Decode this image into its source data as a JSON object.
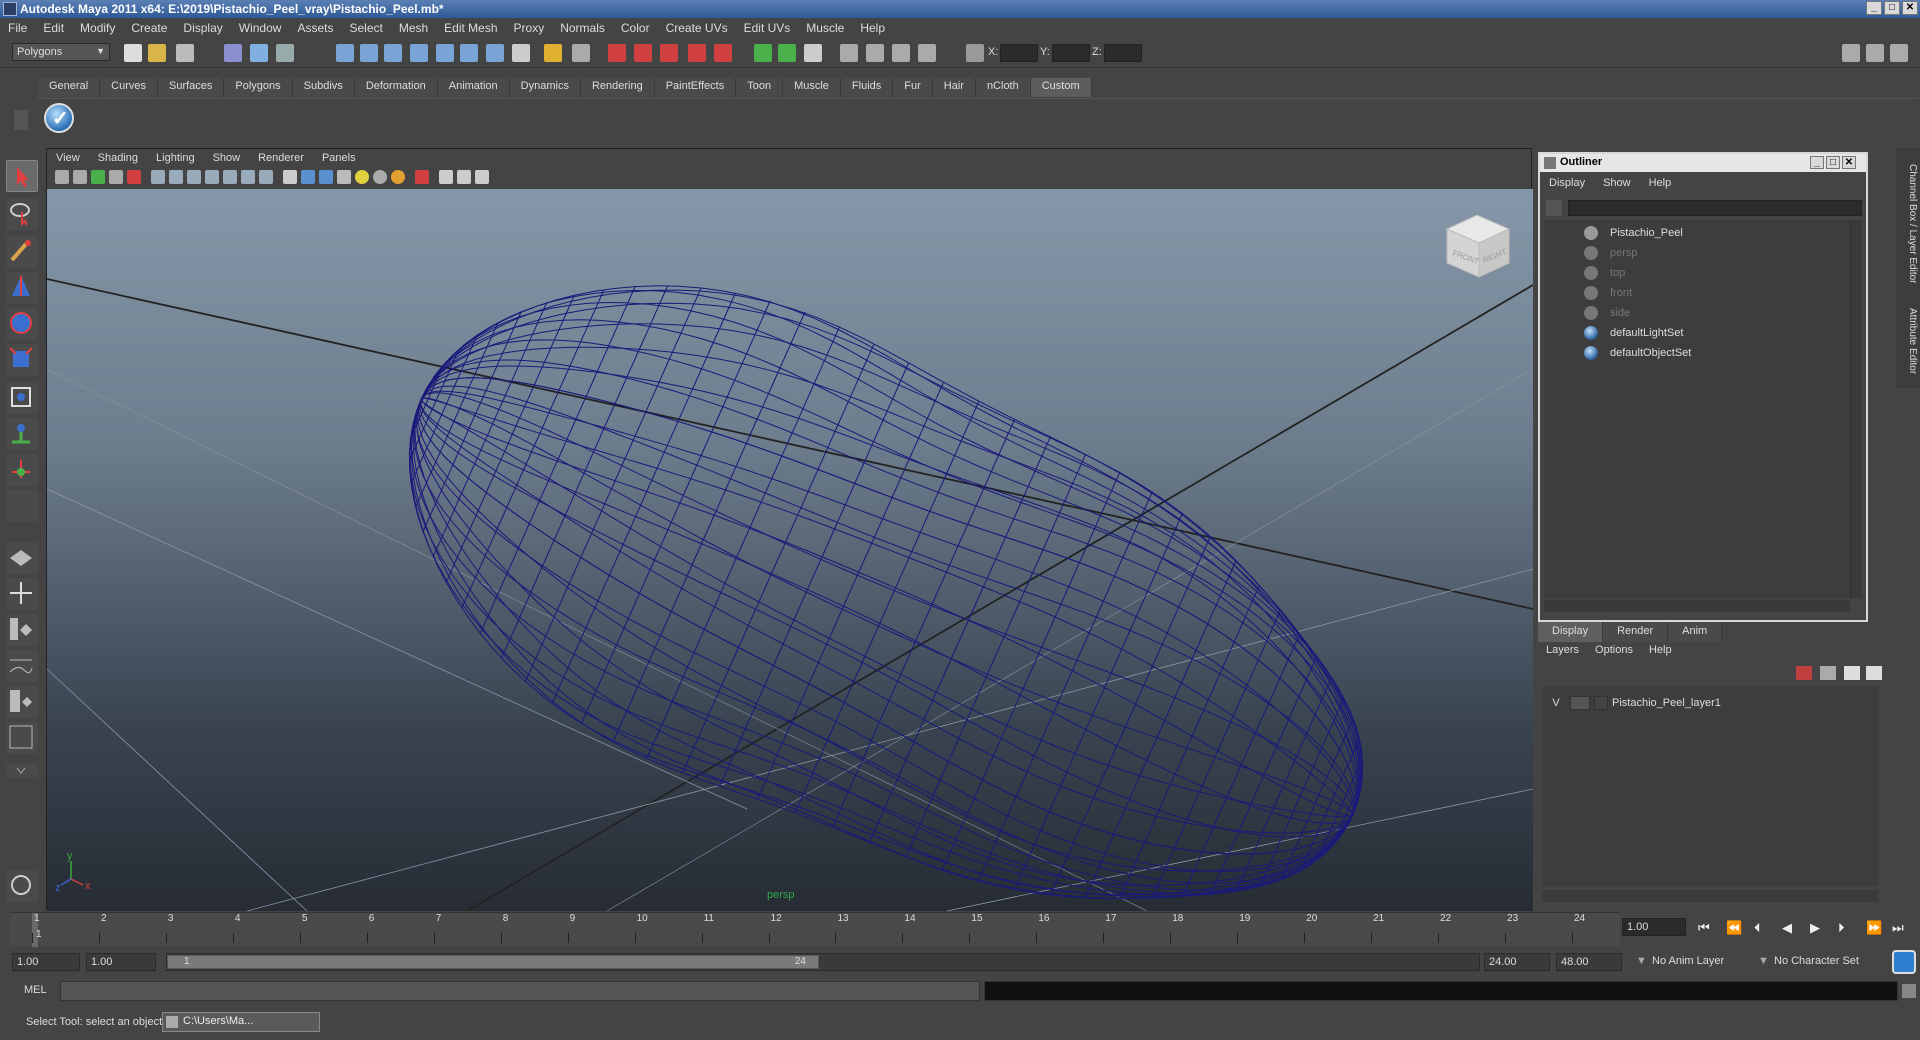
{
  "title": "Autodesk Maya 2011 x64: E:\\2019\\Pistachio_Peel_vray\\Pistachio_Peel.mb*",
  "menu": [
    "File",
    "Edit",
    "Modify",
    "Create",
    "Display",
    "Window",
    "Assets",
    "Select",
    "Mesh",
    "Edit Mesh",
    "Proxy",
    "Normals",
    "Color",
    "Create UVs",
    "Edit UVs",
    "Muscle",
    "Help"
  ],
  "status": {
    "mode": "Polygons",
    "x_label": "X:",
    "y_label": "Y:",
    "z_label": "Z:"
  },
  "shelf_tabs": [
    "General",
    "Curves",
    "Surfaces",
    "Polygons",
    "Subdivs",
    "Deformation",
    "Animation",
    "Dynamics",
    "Rendering",
    "PaintEffects",
    "Toon",
    "Muscle",
    "Fluids",
    "Fur",
    "Hair",
    "nCloth",
    "Custom"
  ],
  "shelf_active_tab": "Custom",
  "viewport": {
    "menu": [
      "View",
      "Shading",
      "Lighting",
      "Show",
      "Renderer",
      "Panels"
    ],
    "camera": "persp",
    "viewcube": {
      "front": "FRONT",
      "right": "RIGHT",
      "top": "TOP"
    },
    "axis": {
      "y": "y",
      "x": "x",
      "z": "z"
    },
    "mesh_color": "#1a1a7a"
  },
  "outliner": {
    "title": "Outliner",
    "menu": [
      "Display",
      "Show",
      "Help"
    ],
    "items": [
      {
        "label": "Pistachio_Peel",
        "dim": false,
        "kind": "mesh"
      },
      {
        "label": "persp",
        "dim": true,
        "kind": "camera"
      },
      {
        "label": "top",
        "dim": true,
        "kind": "camera"
      },
      {
        "label": "front",
        "dim": true,
        "kind": "camera"
      },
      {
        "label": "side",
        "dim": true,
        "kind": "camera"
      },
      {
        "label": "defaultLightSet",
        "dim": false,
        "kind": "set"
      },
      {
        "label": "defaultObjectSet",
        "dim": false,
        "kind": "set"
      }
    ]
  },
  "layer_editor": {
    "tabs": [
      "Display",
      "Render",
      "Anim"
    ],
    "active_tab": "Display",
    "menu": [
      "Layers",
      "Options",
      "Help"
    ],
    "layers": [
      {
        "visible": "V",
        "name": "Pistachio_Peel_layer1"
      }
    ]
  },
  "side_tabs": [
    "Channel Box / Layer Editor",
    "Attribute Editor"
  ],
  "timeline": {
    "ticks": [
      "1",
      "2",
      "3",
      "4",
      "5",
      "6",
      "7",
      "8",
      "9",
      "10",
      "11",
      "12",
      "13",
      "14",
      "15",
      "16",
      "17",
      "18",
      "19",
      "20",
      "21",
      "22",
      "23",
      "24"
    ],
    "current_frame": "1.00",
    "start_marker": "1"
  },
  "range": {
    "start": "1.00",
    "inner_start": "1.00",
    "slider_start": "1",
    "slider_end": "24",
    "end": "24.00",
    "outer_end": "48.00",
    "anim_layer": "No Anim Layer",
    "char_set": "No Character Set"
  },
  "cmd": {
    "label": "MEL"
  },
  "help": {
    "message": "Select Tool: select an object",
    "task": "C:\\Users\\Ma..."
  }
}
